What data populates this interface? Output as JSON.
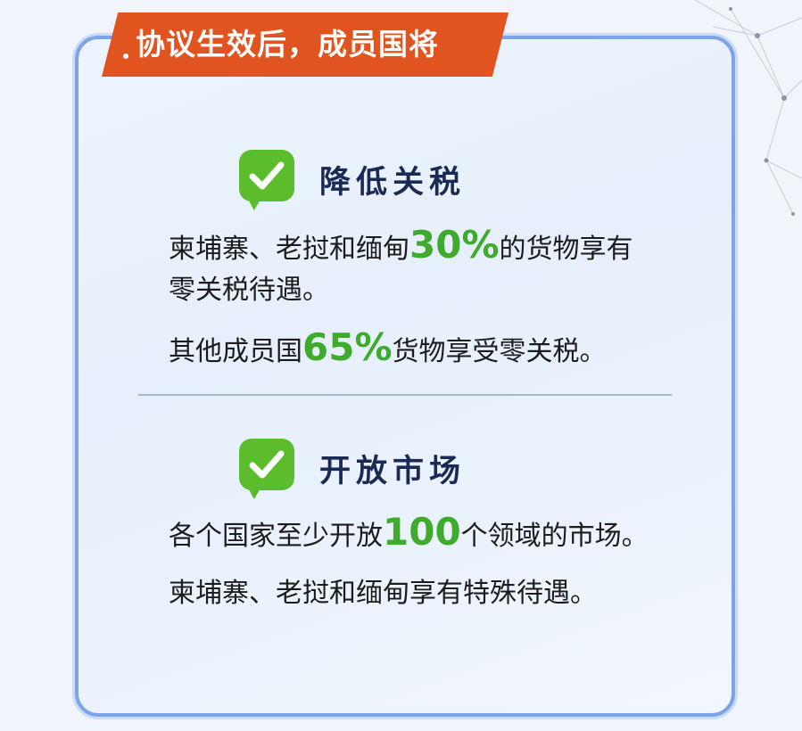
{
  "header": {
    "title": "协议生效后，成员国将"
  },
  "sections": [
    {
      "title": "降低关税",
      "lines": [
        {
          "before": "柬埔寨、老挝和缅甸",
          "highlight": "30%",
          "after": "的货物享有"
        },
        {
          "before": "零关税待遇。",
          "highlight": "",
          "after": ""
        },
        {
          "before": "其他成员国",
          "highlight": "65%",
          "after": "货物享受零关税。"
        }
      ]
    },
    {
      "title": "开放市场",
      "lines": [
        {
          "before": "各个国家至少开放",
          "highlight": "100",
          "after": "个领域的市场。"
        },
        {
          "before": "柬埔寨、老挝和缅甸享有特殊待遇。",
          "highlight": "",
          "after": ""
        }
      ]
    }
  ],
  "colors": {
    "ribbon": "#e2541f",
    "accent_green": "#3eab2d",
    "badge_green": "#5cbd2c",
    "title_navy": "#1a2a52",
    "card_border": "#7ea4e8"
  },
  "icons": {
    "decoration": "network-lines-decoration",
    "section_marker": "checkmark-speech-bubble-icon"
  }
}
